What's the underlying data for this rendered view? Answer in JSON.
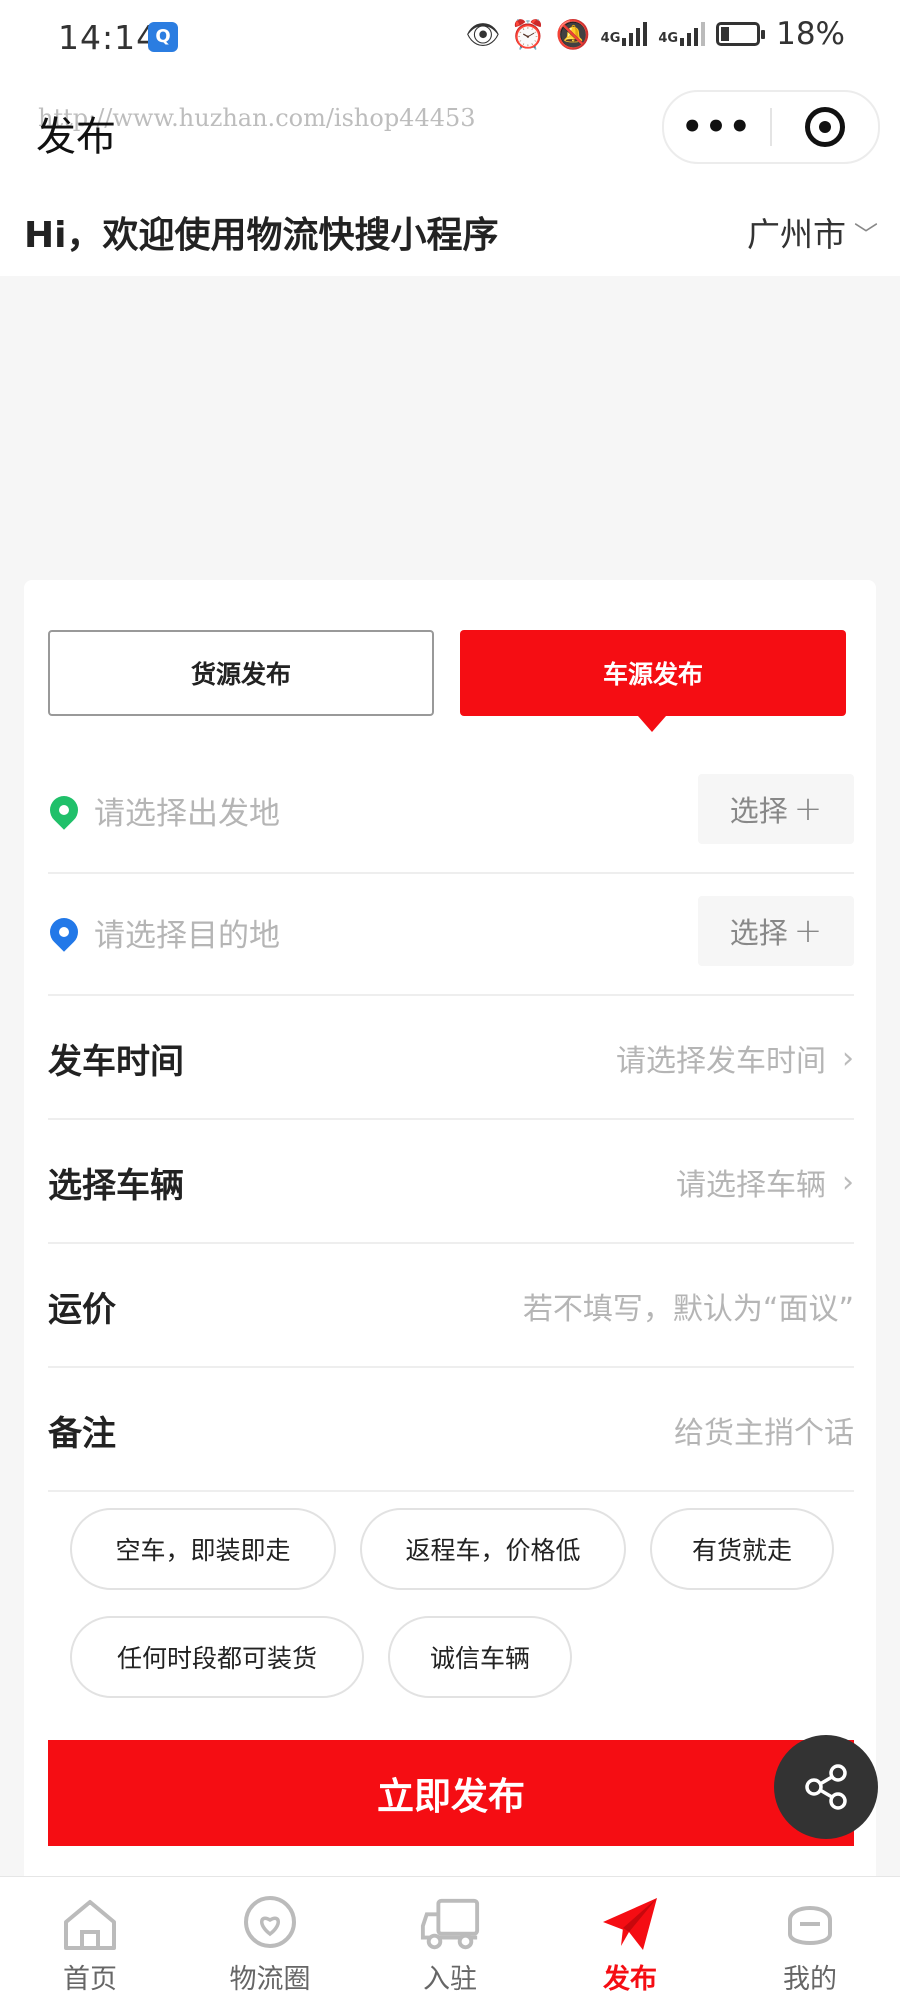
{
  "status_bar": {
    "time": "14:14",
    "network_1": "4G",
    "network_2": "4G",
    "battery_percent": "18%"
  },
  "nav": {
    "title": "发布",
    "watermark": "http://www.huzhan.com/ishop44453"
  },
  "greeting": {
    "text": "Hi，欢迎使用物流快搜小程序",
    "city": "广州市"
  },
  "publish_tabs": [
    {
      "label": "货源发布",
      "active": false
    },
    {
      "label": "车源发布",
      "active": true
    }
  ],
  "locations": {
    "origin_placeholder": "请选择出发地",
    "destination_placeholder": "请选择目的地",
    "choose_label": "选择"
  },
  "fields": {
    "departure_time": {
      "label": "发车时间",
      "placeholder": "请选择发车时间"
    },
    "vehicle": {
      "label": "选择车辆",
      "placeholder": "请选择车辆"
    },
    "freight": {
      "label": "运价",
      "placeholder": "若不填写，默认为“面议”"
    },
    "remark": {
      "label": "备注",
      "placeholder": "给货主捎个话"
    }
  },
  "quick_tags": [
    "空车，即装即走",
    "返程车，价格低",
    "有货就走",
    "任何时段都可装货",
    "诚信车辆"
  ],
  "submit_label": "立即发布",
  "bottom_tabs": [
    {
      "label": "首页",
      "icon": "home-icon"
    },
    {
      "label": "物流圈",
      "icon": "heart-chat-icon"
    },
    {
      "label": "入驻",
      "icon": "truck-icon"
    },
    {
      "label": "发布",
      "icon": "paper-plane-icon",
      "active": true
    },
    {
      "label": "我的",
      "icon": "face-icon"
    }
  ],
  "colors": {
    "accent": "#f50d13",
    "origin_pin": "#20c06a",
    "destination_pin": "#2278e8"
  }
}
